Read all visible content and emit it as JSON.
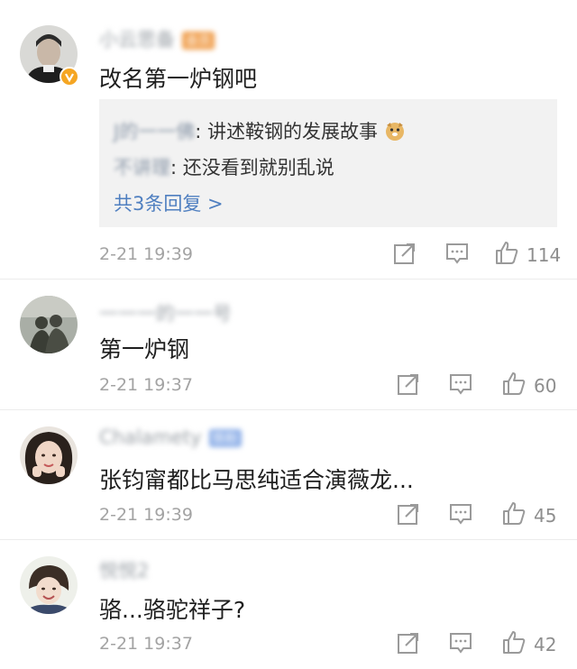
{
  "comments": [
    {
      "username": "小云思备",
      "badge": "会员",
      "text": "改名第一炉钢吧",
      "replies": [
        {
          "name": "J的一一佛",
          "text": "讲述鞍钢的发展故事"
        },
        {
          "name": "不讲理",
          "text": "还没看到就别乱说"
        }
      ],
      "more_replies": "共3条回复 >",
      "time": "2-21 19:39",
      "likes": "114"
    },
    {
      "username": "一一一的一一号",
      "text": "第一炉钢",
      "time": "2-21 19:37",
      "likes": "60"
    },
    {
      "username": "Chalamety",
      "badge": "铁粉",
      "text": "张钧甯都比马思纯适合演薇龙...",
      "time": "2-21 19:39",
      "likes": "45"
    },
    {
      "username": "悦悦2",
      "text": "骆...骆驼祥子?",
      "time": "2-21 19:37",
      "likes": "42"
    }
  ],
  "icons": {
    "share": "share-icon",
    "comment": "comment-icon",
    "like": "thumbs-up-icon",
    "emoji": "doge-emoji-icon",
    "verified": "verified-v-icon"
  },
  "colors": {
    "link": "#4f7fc0",
    "reply_bg": "#f2f2f2",
    "meta": "#a3a3a3",
    "verified_badge": "#f5a623"
  }
}
